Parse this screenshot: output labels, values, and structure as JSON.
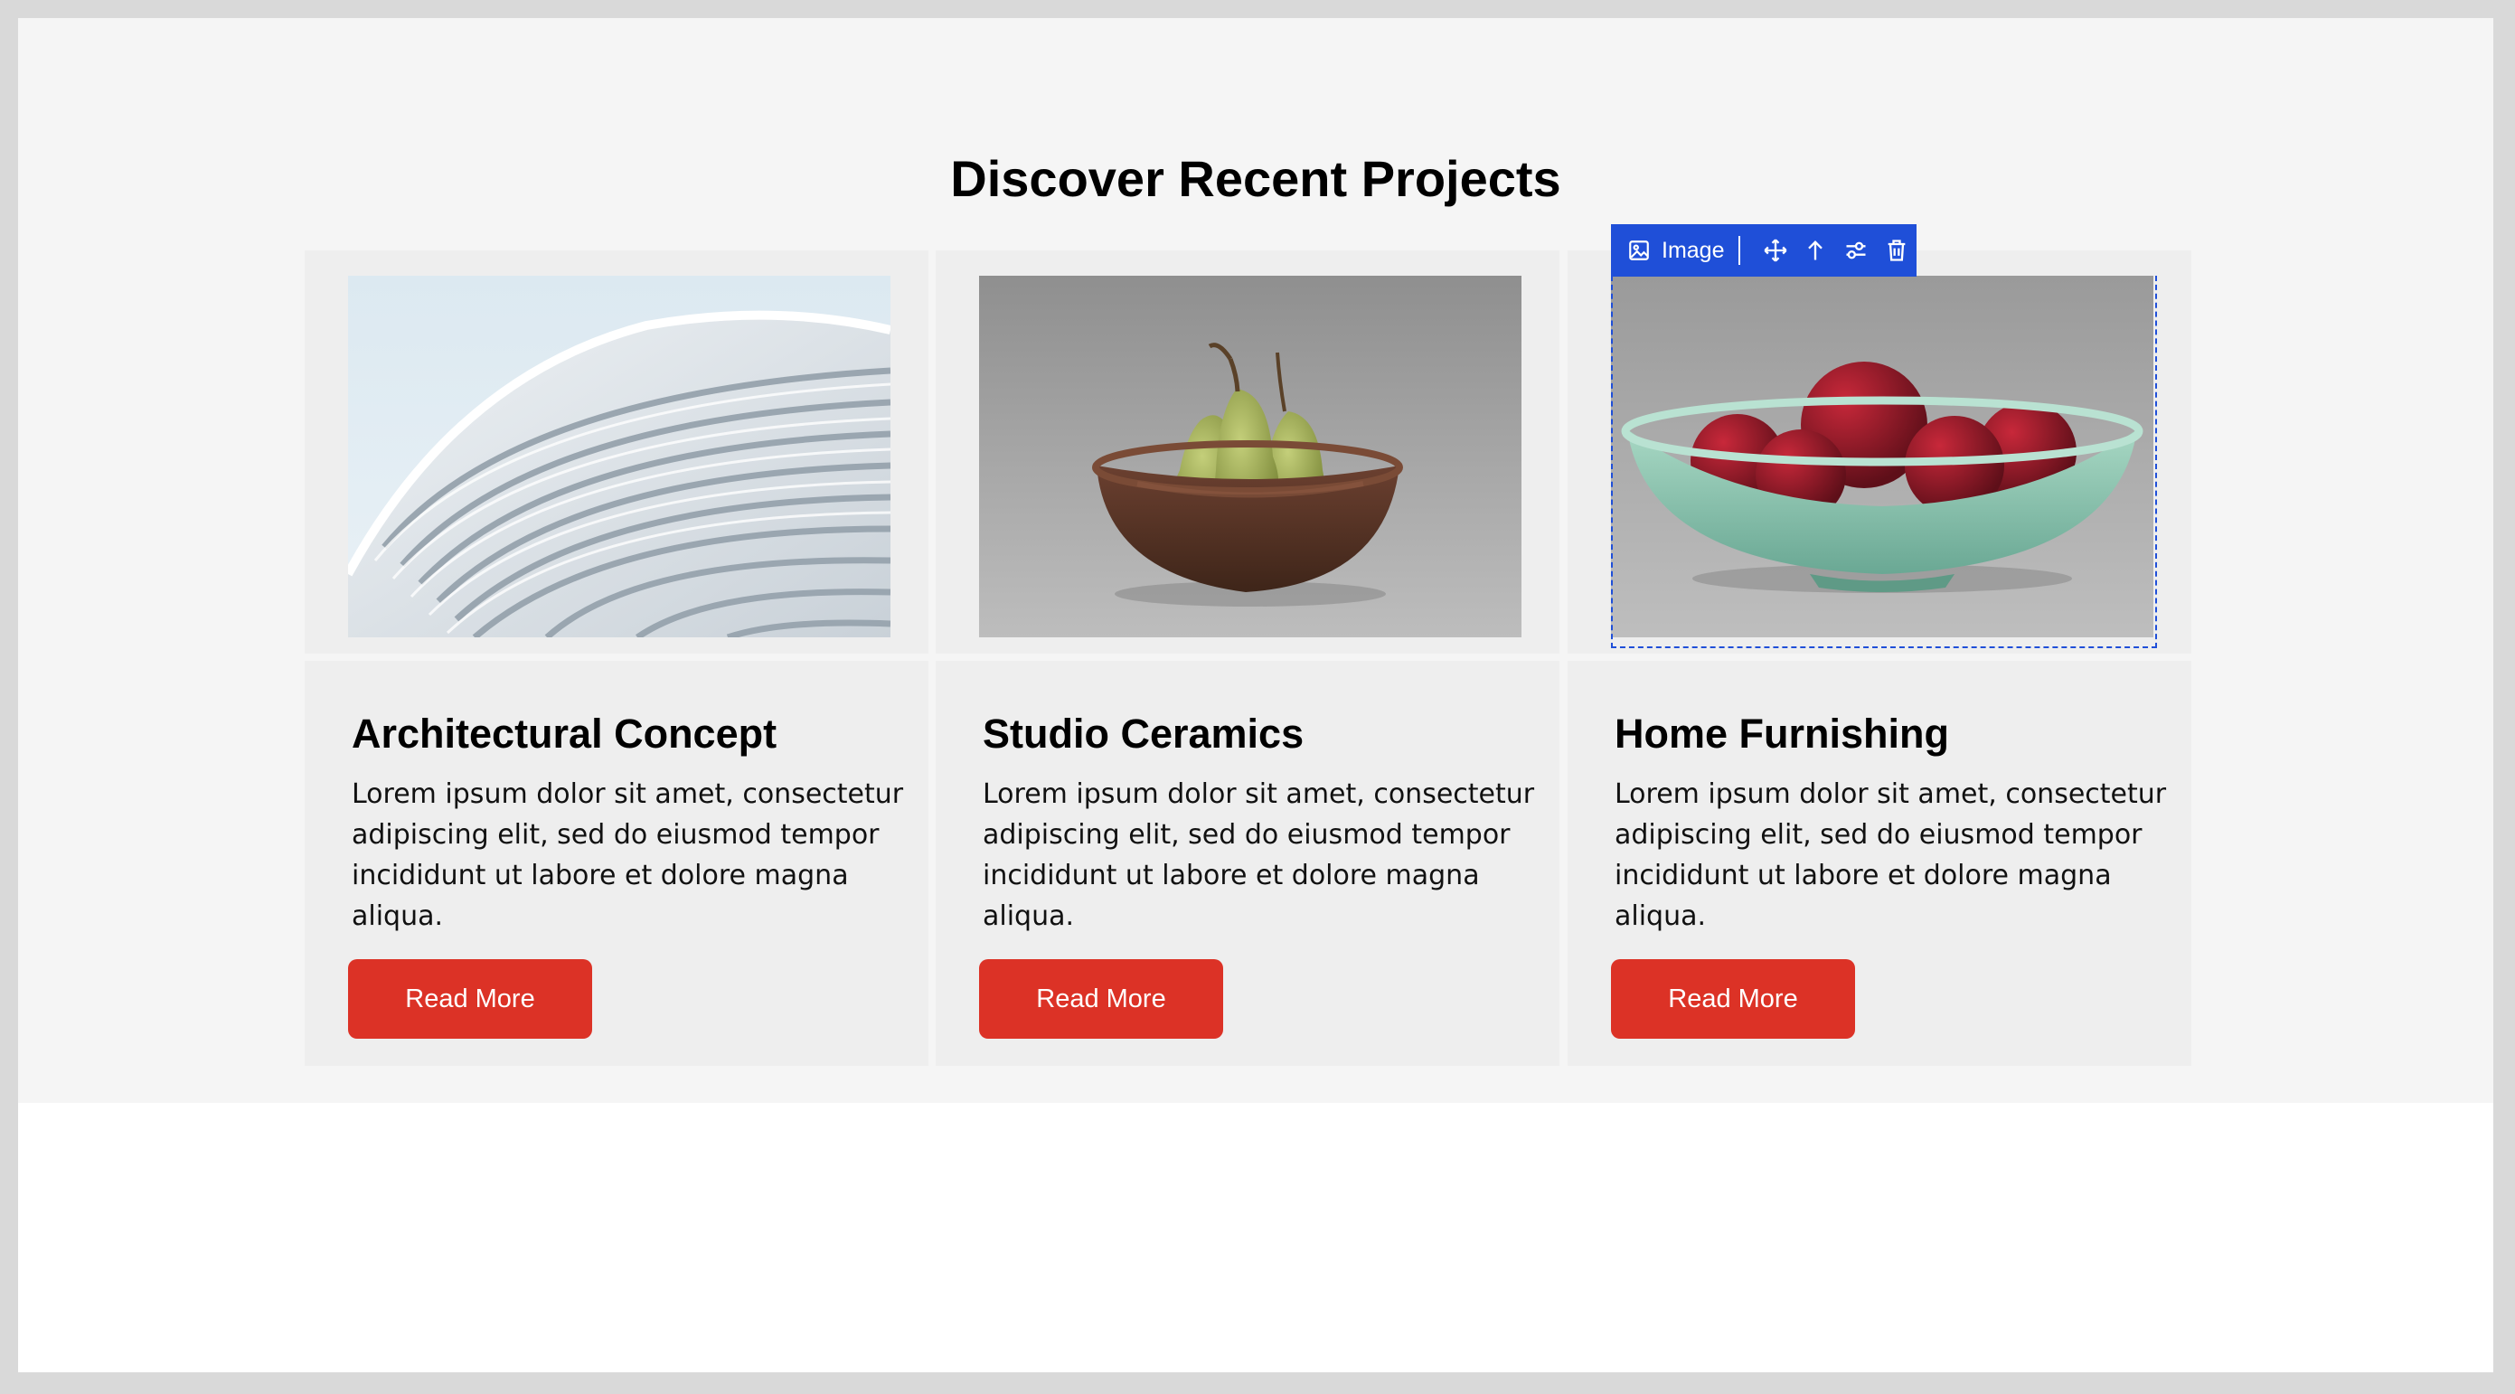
{
  "section": {
    "title": "Discover Recent Projects"
  },
  "cards": [
    {
      "title": "Architectural Concept",
      "text": "Lorem ipsum dolor sit amet, consectetur adipiscing elit, sed do eiusmod tempor incididunt ut labore et dolore magna aliqua.",
      "button": "Read More"
    },
    {
      "title": "Studio Ceramics",
      "text": "Lorem ipsum dolor sit amet, consectetur adipiscing elit, sed do eiusmod tempor incididunt ut labore et dolore magna aliqua.",
      "button": "Read More"
    },
    {
      "title": "Home Furnishing",
      "text": "Lorem ipsum dolor sit amet, consectetur adipiscing elit, sed do eiusmod tempor incididunt ut labore et dolore magna aliqua.",
      "button": "Read More"
    }
  ],
  "toolbar": {
    "label": "Image",
    "icons": [
      "image-icon",
      "move-icon",
      "arrow-up-icon",
      "sliders-icon",
      "trash-icon"
    ]
  },
  "colors": {
    "accent": "#1f4fd8",
    "button": "#dc3226",
    "card_bg": "#eeeeee",
    "section_bg": "#f5f5f5"
  }
}
